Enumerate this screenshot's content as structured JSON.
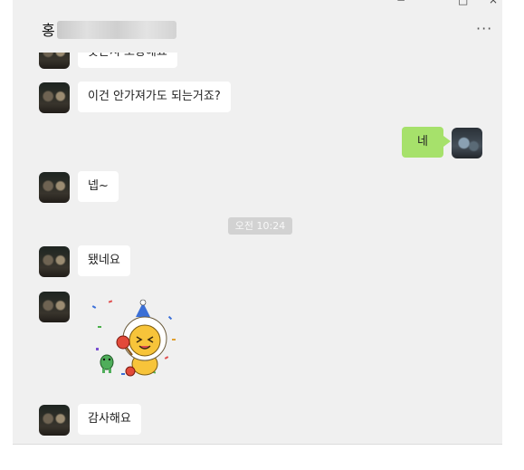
{
  "window_controls": {
    "minimize": "−",
    "maximize": "□",
    "close": "×"
  },
  "header": {
    "title_visible": "홍",
    "more_label": "···"
  },
  "messages": [
    {
      "sender": "other",
      "text": "못본지 오랑해요"
    },
    {
      "sender": "other",
      "text": "이건 안가져가도 되는거죠?"
    },
    {
      "sender": "me",
      "text": "네"
    },
    {
      "sender": "other",
      "text": "넵~"
    },
    {
      "type": "time",
      "text": "오전 10:24"
    },
    {
      "sender": "other",
      "text": "됐네요"
    },
    {
      "sender": "other",
      "type": "sticker",
      "sticker": "party-lion-sticker"
    },
    {
      "sender": "other",
      "text": "감사해요"
    }
  ],
  "colors": {
    "chat_bg": "#f0f0f0",
    "my_bubble": "#a6e16b",
    "other_bubble": "#ffffff",
    "time_badge": "#d2d2d2"
  }
}
